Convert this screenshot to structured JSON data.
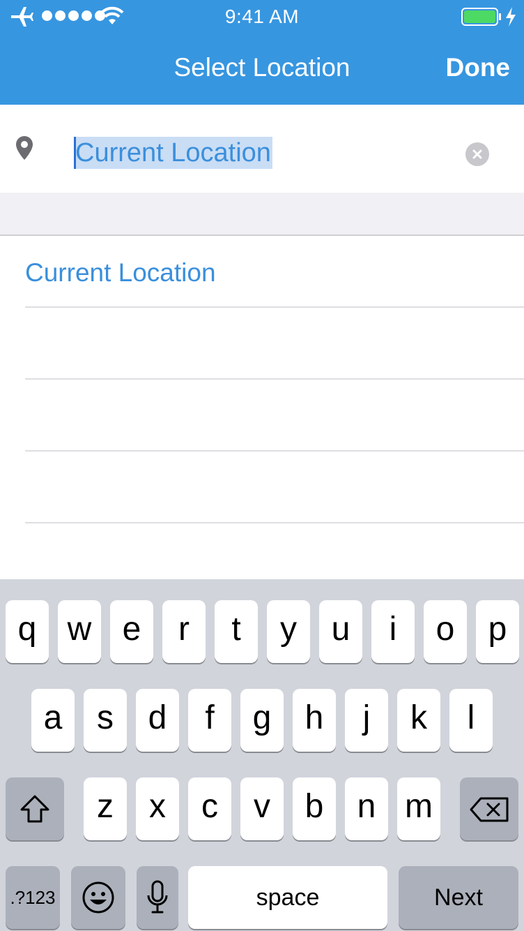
{
  "status_bar": {
    "time": "9:41 AM",
    "icons": [
      "airplane-icon",
      "signal-dots-icon",
      "wifi-icon",
      "battery-icon",
      "charging-icon"
    ]
  },
  "nav": {
    "title": "Select Location",
    "done_label": "Done"
  },
  "search": {
    "value": "Current Location",
    "icon": "map-pin-icon"
  },
  "results": [
    {
      "label": "Current Location"
    },
    {
      "label": ""
    },
    {
      "label": ""
    },
    {
      "label": ""
    }
  ],
  "keyboard": {
    "row1": [
      "q",
      "w",
      "e",
      "r",
      "t",
      "y",
      "u",
      "i",
      "o",
      "p"
    ],
    "row2": [
      "a",
      "s",
      "d",
      "f",
      "g",
      "h",
      "j",
      "k",
      "l"
    ],
    "row3": [
      "z",
      "x",
      "c",
      "v",
      "b",
      "n",
      "m"
    ],
    "numbers_label": ".?123",
    "space_label": "space",
    "next_label": "Next"
  },
  "colors": {
    "header": "#3796e0",
    "accent_text": "#3a8fdc",
    "keyboard_bg": "#d1d4db",
    "dark_key": "#abb0ba"
  }
}
